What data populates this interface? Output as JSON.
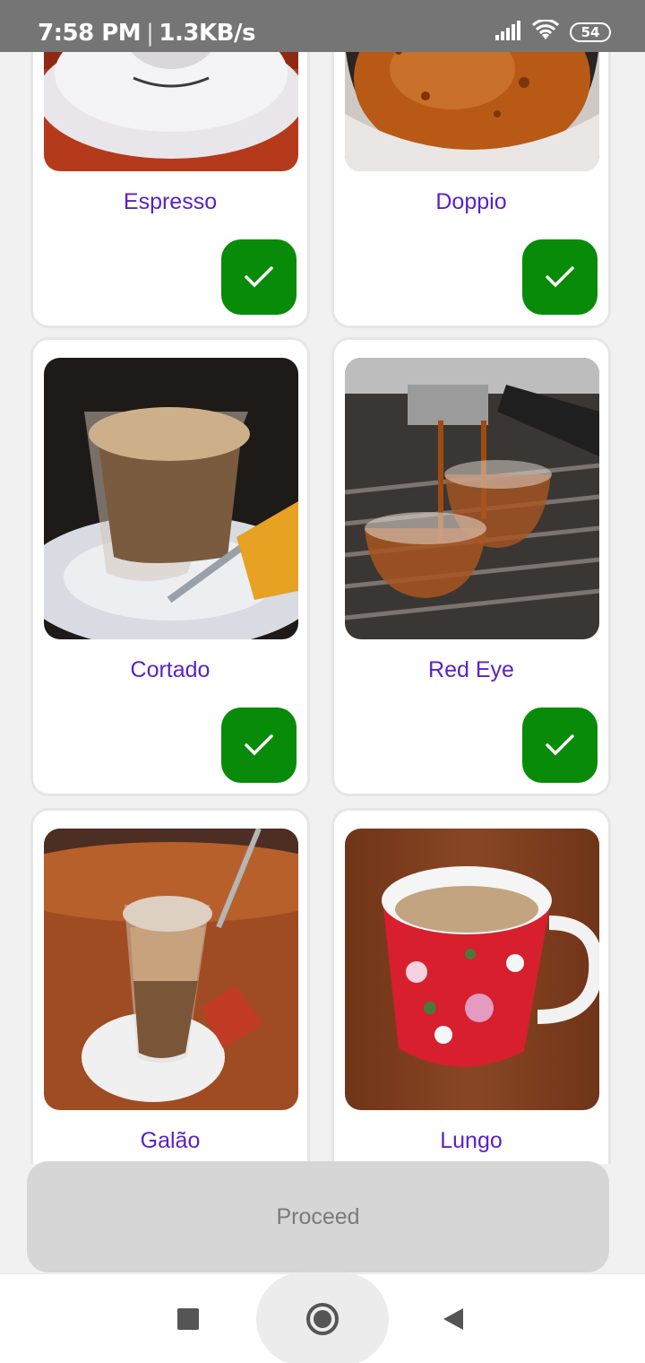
{
  "status_bar": {
    "time": "7:58 PM",
    "separator": "|",
    "net_speed": "1.3KB/s",
    "battery": "54",
    "icons": [
      "signal-icon",
      "wifi-icon",
      "battery-icon"
    ]
  },
  "items": [
    {
      "name": "Espresso",
      "selected": true
    },
    {
      "name": "Doppio",
      "selected": true
    },
    {
      "name": "Cortado",
      "selected": true
    },
    {
      "name": "Red Eye",
      "selected": true
    },
    {
      "name": "Galão",
      "selected": false
    },
    {
      "name": "Lungo",
      "selected": false
    }
  ],
  "proceed_label": "Proceed",
  "nav": {
    "icons": [
      "recents-square-icon",
      "home-circle-icon",
      "back-triangle-icon"
    ]
  },
  "colors": {
    "accent_text": "#5b1fc9",
    "check_bg": "#088b08",
    "status_bar": "#757575",
    "proceed_bg": "#d6d6d6"
  }
}
